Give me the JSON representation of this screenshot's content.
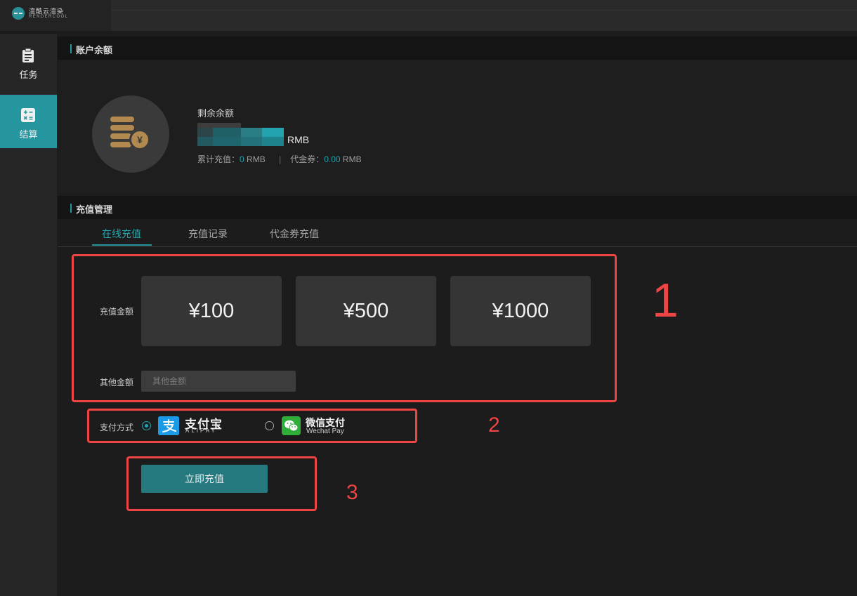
{
  "app": {
    "logo_cn": "渲酷云渲染",
    "logo_en": "RENDERCOOL"
  },
  "sidebar": {
    "items": [
      {
        "label": "任务",
        "icon": "clipboard-icon",
        "active": false
      },
      {
        "label": "结算",
        "icon": "calculator-icon",
        "active": true
      }
    ]
  },
  "balance": {
    "section_title": "账户余额",
    "label": "剩余余额",
    "unit": "RMB",
    "total_recharge_label": "累计充值：",
    "total_recharge_value": "0",
    "total_recharge_unit": "RMB",
    "separator": "|",
    "voucher_label": "代金券：",
    "voucher_value": "0.00",
    "voucher_unit": "RMB"
  },
  "recharge": {
    "section_title": "充值管理",
    "tabs": [
      {
        "label": "在线充值",
        "active": true
      },
      {
        "label": "充值记录",
        "active": false
      },
      {
        "label": "代金券充值",
        "active": false
      }
    ],
    "amount_label": "充值金额",
    "amounts": [
      "¥100",
      "¥500",
      "¥1000"
    ],
    "other_label": "其他金额",
    "other_placeholder": "其他金额",
    "payment_label": "支付方式",
    "payments": [
      {
        "name": "支付宝",
        "subtitle": "ALIPAY",
        "icon": "alipay-icon",
        "selected": true
      },
      {
        "name": "微信支付",
        "subtitle": "Wechat Pay",
        "icon": "wechat-icon",
        "selected": false
      }
    ],
    "submit_label": "立即充值"
  },
  "annotations": [
    "1",
    "2",
    "3"
  ],
  "colors": {
    "accent": "#25969f",
    "annotation": "#ee4444",
    "alipay": "#1b9be6",
    "wechat": "#2fae3a"
  }
}
